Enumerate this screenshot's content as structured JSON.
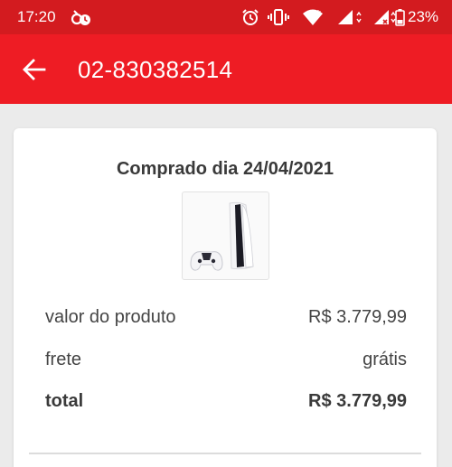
{
  "status_bar": {
    "time": "17:20",
    "battery": "23%",
    "icons": [
      "voicemail-icon",
      "alarm-icon",
      "vibrate-icon",
      "wifi-icon",
      "signal-icon",
      "signal-no-data-icon",
      "battery-icon"
    ]
  },
  "header": {
    "title": "02-830382514",
    "back_icon": "arrow-left-icon"
  },
  "order": {
    "purchase_date": "Comprado dia 24/04/2021",
    "product_image": "console-with-controller",
    "rows": [
      {
        "label": "valor do produto",
        "value": "R$ 3.779,99"
      },
      {
        "label": "frete",
        "value": "grátis"
      },
      {
        "label": "total",
        "value": "R$ 3.779,99"
      }
    ]
  },
  "colors": {
    "status_bar": "#d31b1f",
    "app_bar": "#ee1c24",
    "background": "#ebebeb"
  }
}
